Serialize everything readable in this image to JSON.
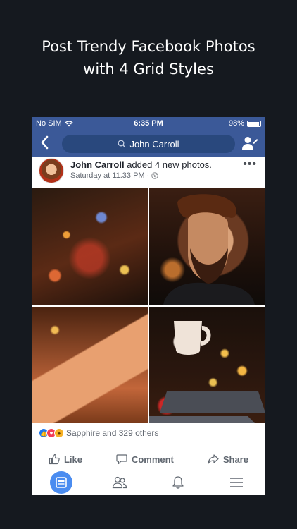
{
  "headline": {
    "line1": "Post Trendy Facebook Photos",
    "line2": "with 4 Grid Styles"
  },
  "status_bar": {
    "carrier": "No SIM",
    "time": "6:35 PM",
    "battery": "98%"
  },
  "nav": {
    "back_icon": "chevron-left-icon",
    "search_text": "John Carroll",
    "search_icon": "search-icon",
    "friend_icon": "edit-friend-icon"
  },
  "post": {
    "author": "John Carroll",
    "action": "added 4 new photos.",
    "timestamp": "Saturday at 11.33 PM ·",
    "privacy_icon": "globe-icon",
    "more": "•••",
    "photos": [
      "bokeh-lights",
      "man-portrait",
      "laptop-closeup",
      "mug-with-bokeh"
    ]
  },
  "reactions": {
    "icons": [
      "like-icon",
      "love-icon",
      "wow-icon"
    ],
    "summary": "Sapphire and 329 others"
  },
  "actions": {
    "like": "Like",
    "comment": "Comment",
    "share": "Share"
  },
  "tabbar": {
    "items": [
      "news-feed-icon",
      "friends-icon",
      "notifications-icon",
      "menu-icon"
    ]
  },
  "colors": {
    "background": "#15191f",
    "facebook_blue": "#3b5998",
    "search_pill": "#29487d",
    "active_tab": "#4a8cf0"
  }
}
